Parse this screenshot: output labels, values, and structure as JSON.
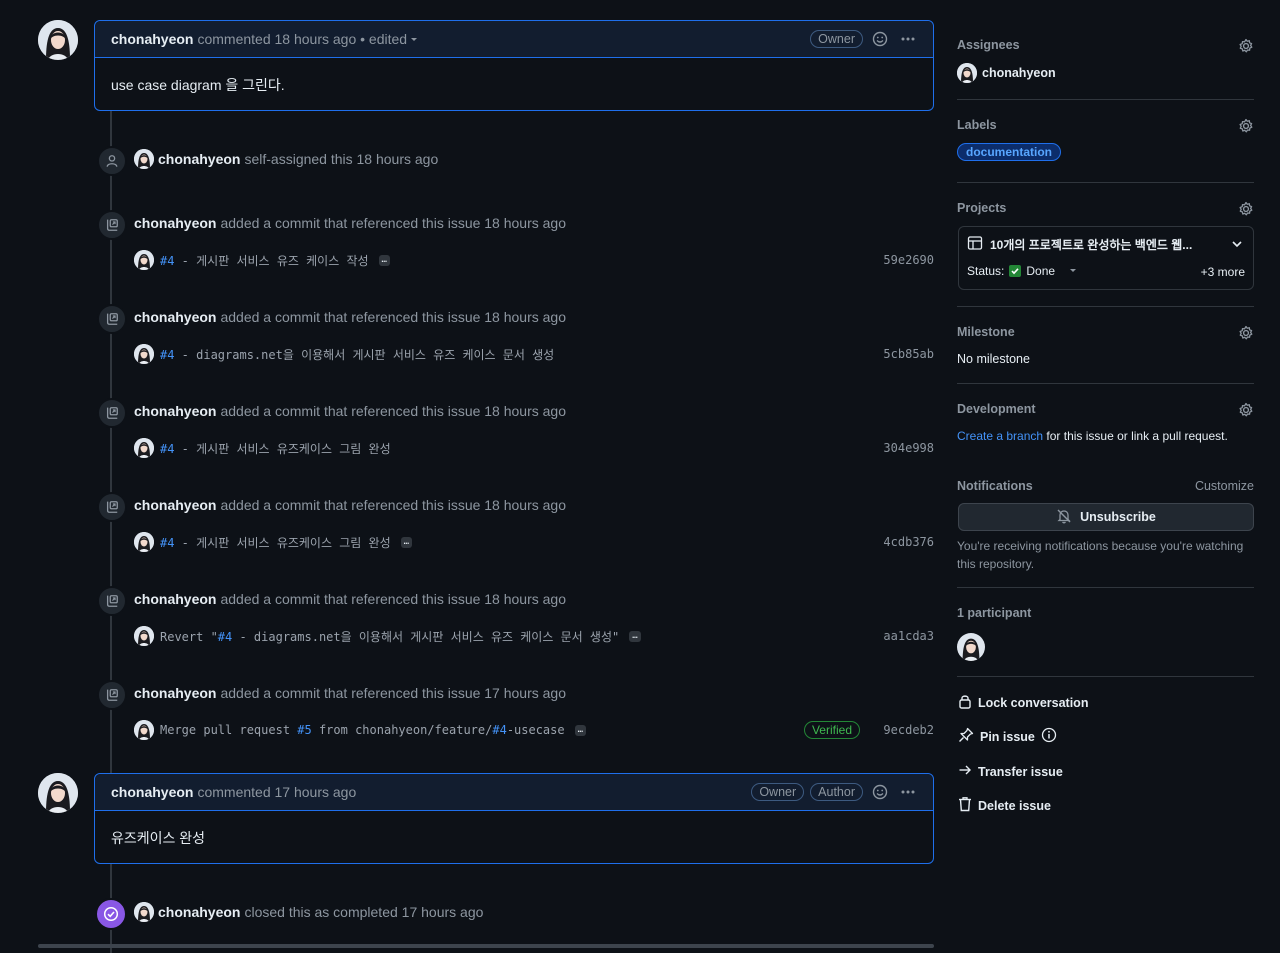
{
  "comments": [
    {
      "author": "chonahyeon",
      "meta": "commented 18 hours ago • edited",
      "badges": [
        "Owner"
      ],
      "body": "use case diagram 을 그린다."
    },
    {
      "author": "chonahyeon",
      "meta": "commented 17 hours ago",
      "badges": [
        "Owner",
        "Author"
      ],
      "body": "유즈케이스 완성"
    }
  ],
  "assign_event": {
    "who": "chonahyeon",
    "text": "self-assigned this 18 hours ago"
  },
  "commit_events": [
    {
      "who": "chonahyeon",
      "text": "added a commit that referenced this issue 18 hours ago",
      "prefix": "",
      "ref": "#4",
      "message": " - 게시판 서비스 유즈 케이스 작성",
      "suffix": "",
      "sha": "59e2690",
      "ellipsis": "…",
      "verified": ""
    },
    {
      "who": "chonahyeon",
      "text": "added a commit that referenced this issue 18 hours ago",
      "prefix": "",
      "ref": "#4",
      "message": " - diagrams.net을 이용해서 게시판 서비스 유즈 케이스 문서 생성",
      "suffix": "",
      "sha": "5cb85ab",
      "ellipsis": "",
      "verified": ""
    },
    {
      "who": "chonahyeon",
      "text": "added a commit that referenced this issue 18 hours ago",
      "prefix": "",
      "ref": "#4",
      "message": " - 게시판 서비스 유즈케이스 그림 완성",
      "suffix": "",
      "sha": "304e998",
      "ellipsis": "",
      "verified": ""
    },
    {
      "who": "chonahyeon",
      "text": "added a commit that referenced this issue 18 hours ago",
      "prefix": "",
      "ref": "#4",
      "message": " - 게시판 서비스 유즈케이스 그림 완성",
      "suffix": "",
      "sha": "4cdb376",
      "ellipsis": "…",
      "verified": ""
    },
    {
      "who": "chonahyeon",
      "text": "added a commit that referenced this issue 18 hours ago",
      "prefix": "Revert \"",
      "ref": "#4",
      "message": " - diagrams.net을 이용해서 게시판 서비스 유즈 케이스 문서 생성\"",
      "suffix": "",
      "sha": "aa1cda3",
      "ellipsis": "…",
      "verified": ""
    },
    {
      "who": "chonahyeon",
      "text": "added a commit that referenced this issue 17 hours ago",
      "prefix": "Merge pull request ",
      "ref": "#5",
      "message": " from chonahyeon/feature/",
      "suffix": "#4",
      "suffix2": "-usecase",
      "sha": "9ecdeb2",
      "ellipsis": "…",
      "verified": "Verified"
    }
  ],
  "close_event": {
    "who": "chonahyeon",
    "text": "closed this as completed 17 hours ago"
  },
  "sidebar": {
    "assignees": {
      "title": "Assignees",
      "user": "chonahyeon"
    },
    "labels": {
      "title": "Labels",
      "items": [
        "documentation"
      ]
    },
    "projects": {
      "title": "Projects",
      "name": "10개의 프로젝트로 완성하는 백엔드 웹...",
      "status_label": "Status:",
      "status_value": "Done",
      "more": "+3 more"
    },
    "milestone": {
      "title": "Milestone",
      "value": "No milestone"
    },
    "development": {
      "title": "Development",
      "link": "Create a branch",
      "text": " for this issue or link a pull request."
    },
    "notifications": {
      "title": "Notifications",
      "customize": "Customize",
      "button": "Unsubscribe",
      "note": "You're receiving notifications because you're watching this repository."
    },
    "participants": {
      "title": "1 participant"
    },
    "actions": {
      "lock": "Lock conversation",
      "pin": "Pin issue",
      "transfer": "Transfer issue",
      "delete": "Delete issue"
    }
  },
  "colors": {
    "accent": "#1f6feb",
    "link": "#4493f8",
    "done": "#3fb950",
    "closed": "#8957e5",
    "bg": "#0d1117"
  }
}
